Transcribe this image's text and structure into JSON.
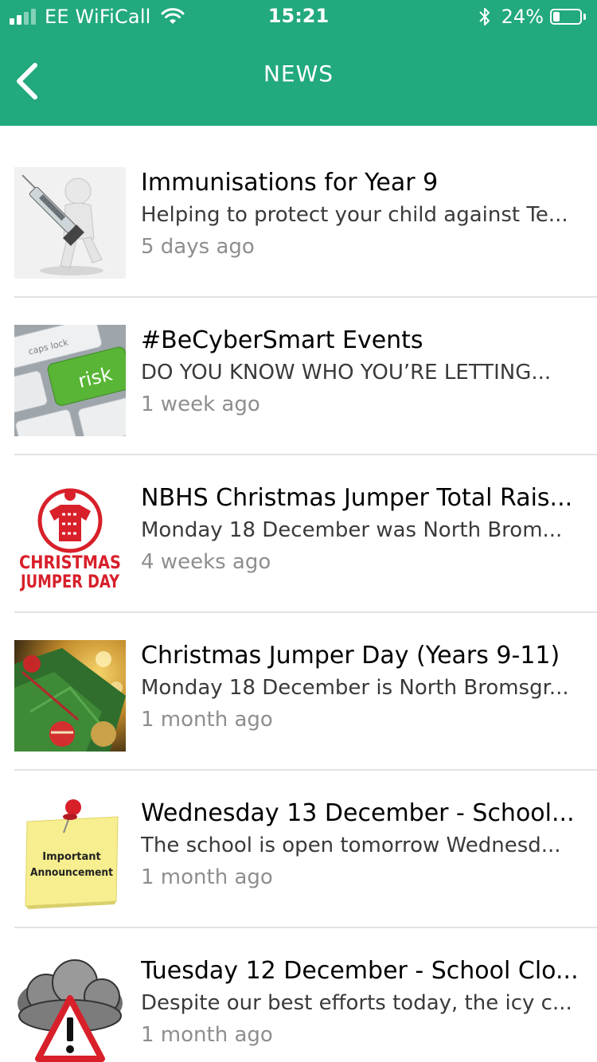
{
  "status_bar": {
    "carrier": "EE WiFiCall",
    "time": "15:21",
    "battery_percent": "24%",
    "battery_level": 0.24,
    "signal_bars_active": 2,
    "signal_bars_total": 4
  },
  "header": {
    "title": "NEWS",
    "back_icon": "chevron-left-icon",
    "background_color": "#22a97e"
  },
  "news": [
    {
      "title": "Immunisations for Year 9",
      "summary": "Helping to protect your child against Te...",
      "time": "5 days ago",
      "thumbnail": "syringe-figure-image"
    },
    {
      "title": "#BeCyberSmart Events",
      "summary": "DO YOU KNOW WHO YOU’RE LETTING...",
      "time": "1 week ago",
      "thumbnail": "keyboard-risk-key-image",
      "thumb_text": {
        "key1": "caps lock",
        "key2": "risk"
      }
    },
    {
      "title": "NBHS Christmas Jumper Total Rais...",
      "summary": "Monday 18 December was North Brom...",
      "time": "4 weeks ago",
      "thumbnail": "christmas-jumper-day-logo",
      "thumb_text": {
        "line1": "CHRISTMAS",
        "line2": "JUMPER DAY"
      }
    },
    {
      "title": "Christmas Jumper Day (Years 9-11)",
      "summary": "Monday 18 December is North Bromsgr...",
      "time": "1 month ago",
      "thumbnail": "christmas-tree-baubles-image"
    },
    {
      "title": "Wednesday 13 December - School...",
      "summary": "The school is open tomorrow Wednesd...",
      "time": "1 month ago",
      "thumbnail": "important-announcement-note-image",
      "thumb_text": {
        "line1": "Important",
        "line2": "Announcement"
      }
    },
    {
      "title": "Tuesday 12 December - School Clo...",
      "summary": "Despite our best efforts today, the icy c...",
      "time": "1 month ago",
      "thumbnail": "storm-cloud-warning-image"
    }
  ]
}
